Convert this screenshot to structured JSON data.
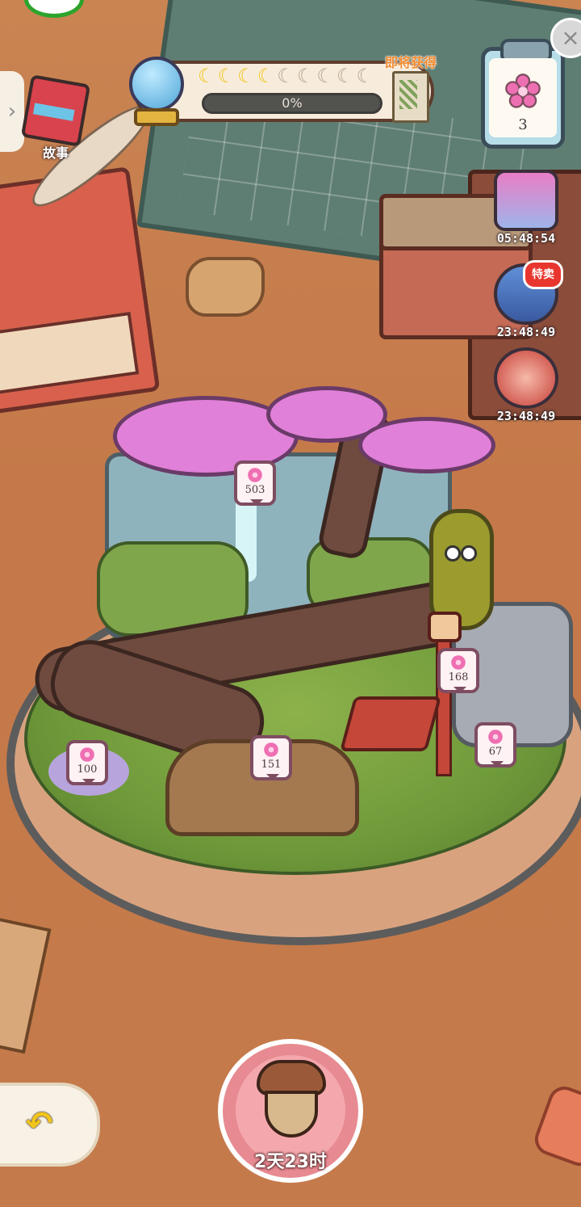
{
  "hud": {
    "story_label": "故事",
    "progress_text": "0%",
    "progress_value": 0,
    "moons_filled": 4,
    "moons_total": 9,
    "upcoming_reward_label": "即将获得"
  },
  "task_board": {
    "count": "3"
  },
  "side_offers": [
    {
      "timer": "05:48:54",
      "icon": "flower-gift-box"
    },
    {
      "timer": "23:48:49",
      "icon": "machine-sale",
      "badge": "特卖"
    },
    {
      "timer": "23:48:49",
      "icon": "piggy-bank"
    }
  ],
  "pins": [
    {
      "value": "503"
    },
    {
      "value": "168"
    },
    {
      "value": "100"
    },
    {
      "value": "151"
    },
    {
      "value": "67"
    }
  ],
  "acorn_button": {
    "timer": "2天23时"
  },
  "colors": {
    "accent": "#f2c51b",
    "pin_border": "#7e4d61",
    "blossom": "#e080d8",
    "acorn_button": "#e78a91"
  }
}
